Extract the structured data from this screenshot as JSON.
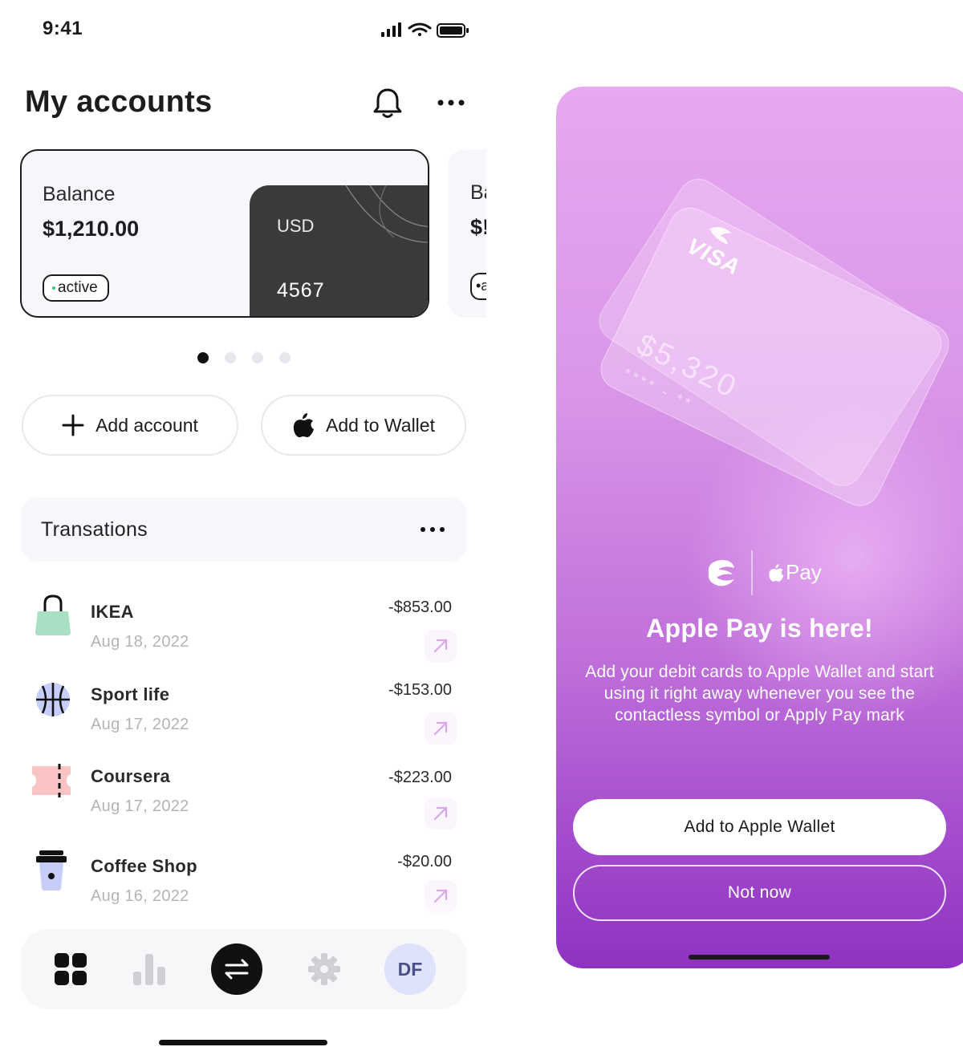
{
  "status_bar": {
    "time": "9:41"
  },
  "header": {
    "title": "My accounts",
    "notification_icon": "bell-icon",
    "more_icon": "more-horizontal-icon"
  },
  "accounts": [
    {
      "label": "Balance",
      "value": "$1,210.00",
      "status": "active",
      "currency": "USD",
      "card_last4": "4567"
    },
    {
      "label": "Ba",
      "value": "$!",
      "status": "•a"
    }
  ],
  "pager": {
    "count": 4,
    "active_index": 0
  },
  "actions": {
    "add_account": "Add account",
    "add_to_wallet": "Add to Wallet"
  },
  "transactions": {
    "title": "Transations",
    "items": [
      {
        "name": "IKEA",
        "date": "Aug 18, 2022",
        "amount": "-$853.00",
        "icon": "shopping-bag-icon",
        "icon_color": "#a8e0c4"
      },
      {
        "name": "Sport life",
        "date": "Aug 17, 2022",
        "amount": "-$153.00",
        "icon": "basketball-icon",
        "icon_color": "#c7cdfa"
      },
      {
        "name": "Coursera",
        "date": "Aug 17, 2022",
        "amount": "-$223.00",
        "icon": "ticket-icon",
        "icon_color": "#fbc4c4"
      },
      {
        "name": "Coffee Shop",
        "date": "Aug 16, 2022",
        "amount": "-$20.00",
        "icon": "coffee-cup-icon",
        "icon_color": "#c7cdfa"
      }
    ]
  },
  "tabbar": {
    "items": [
      "dashboard-icon",
      "stats-icon",
      "transfer-icon",
      "settings-icon"
    ],
    "avatar_initials": "DF",
    "active_index": 2
  },
  "apple_pay": {
    "card_brand": "VISA",
    "card_amount": "$5,320",
    "card_number_mask": "**** - **",
    "pay_logo": "Pay",
    "title": "Apple Pay is here!",
    "description": "Add your debit cards to Apple Wallet and start using it right away whenever you see the contactless symbol or Apply Pay mark",
    "primary_button": "Add to Apple Wallet",
    "secondary_button": "Not now"
  },
  "colors": {
    "accent": "#111111",
    "gradient_top": "#e6a8ef",
    "gradient_bottom": "#8f32c3",
    "arrow": "#d9a6ec"
  }
}
